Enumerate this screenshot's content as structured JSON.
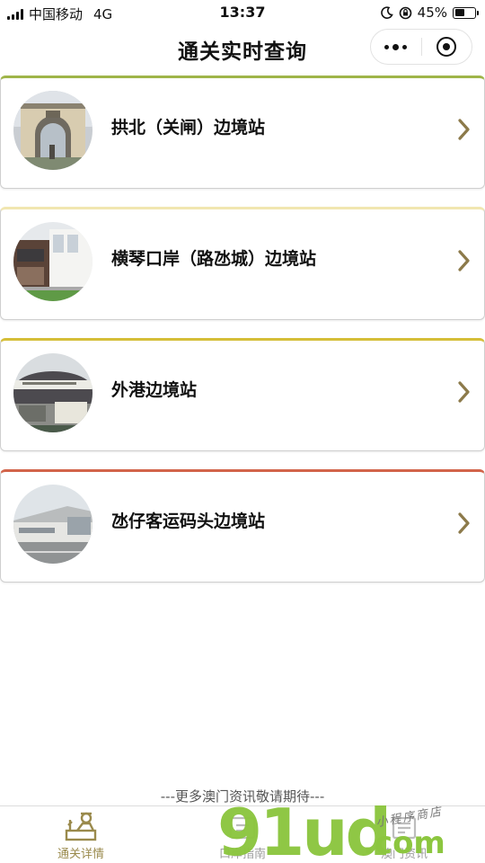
{
  "status_bar": {
    "carrier": "中国移动",
    "network": "4G",
    "time": "13:37",
    "battery": "45%",
    "battery_level": 0.45
  },
  "nav": {
    "title": "通关实时查询",
    "more_icon": "more-dots-icon",
    "close_icon": "target-circle-icon"
  },
  "stations": [
    {
      "name": "拱北（关闸）边境站",
      "accent": "#9fb548",
      "icon": "chevron-right-icon"
    },
    {
      "name": "横琴口岸（路氹城）边境站",
      "accent": "#f1e6b0",
      "icon": "chevron-right-icon"
    },
    {
      "name": "外港边境站",
      "accent": "#d5be38",
      "icon": "chevron-right-icon"
    },
    {
      "name": "氹仔客运码头边境站",
      "accent": "#d2644a",
      "icon": "chevron-right-icon"
    }
  ],
  "footer_note": "---更多澳门资讯敬请期待---",
  "tabs": [
    {
      "label": "通关详情",
      "active": true,
      "icon": "customs-officer-icon"
    },
    {
      "label": "口岸指南",
      "active": false,
      "icon": "guide-icon"
    },
    {
      "label": "澳门资讯",
      "active": false,
      "icon": "news-icon"
    }
  ],
  "watermark": {
    "brand": "91ud",
    "domain": ".com",
    "tagline": "小程序商店"
  },
  "colors": {
    "tab_active": "#9a8a4c",
    "chevron": "#8c7a4a",
    "watermark_green": "#8cc63f"
  }
}
